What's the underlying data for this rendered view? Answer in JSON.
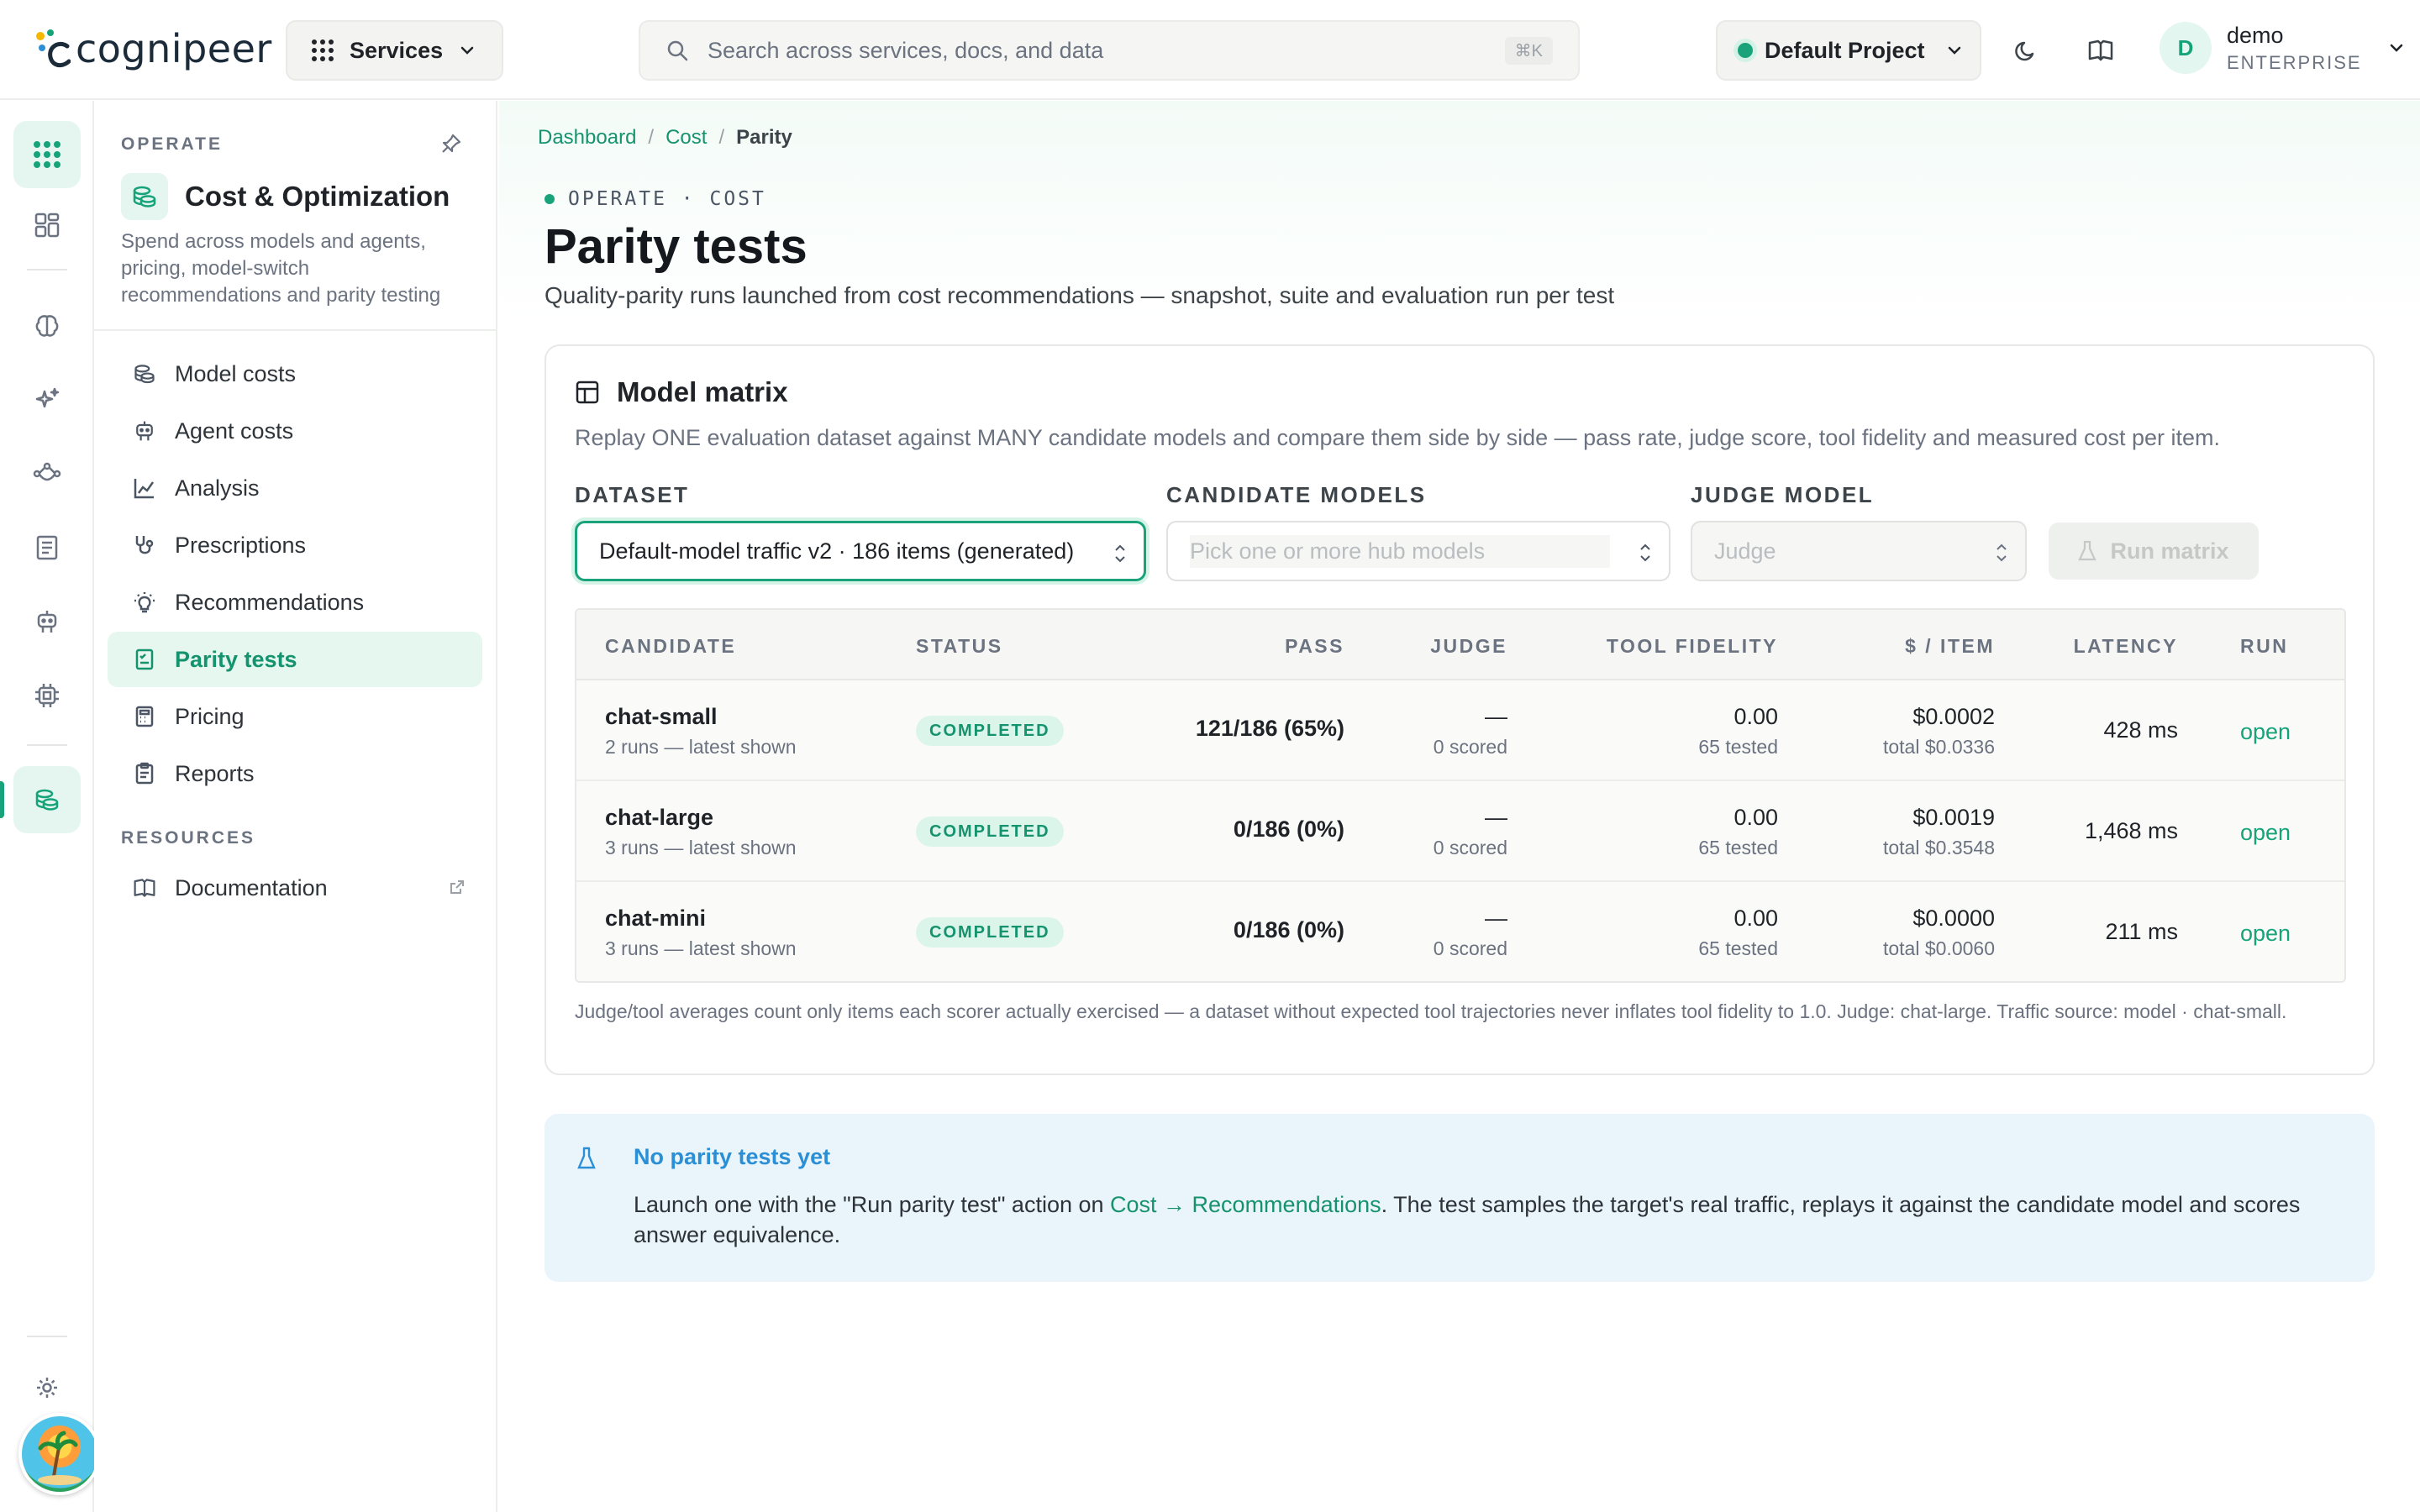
{
  "app": {
    "logo_text": "cognipeer",
    "services_label": "Services",
    "search_placeholder": "Search across services, docs, and data",
    "search_shortcut": "⌘K",
    "project_label": "Default Project",
    "user_name": "demo",
    "user_plan": "ENTERPRISE",
    "user_initial": "D"
  },
  "sidebar": {
    "section_operate": "OPERATE",
    "title": "Cost & Optimization",
    "description": "Spend across models and agents, pricing, model-switch recommendations and parity testing",
    "items": [
      {
        "label": "Model costs",
        "icon": "coins-icon"
      },
      {
        "label": "Agent costs",
        "icon": "robot-icon"
      },
      {
        "label": "Analysis",
        "icon": "chart-icon"
      },
      {
        "label": "Prescriptions",
        "icon": "stethoscope-icon"
      },
      {
        "label": "Recommendations",
        "icon": "lightbulb-icon"
      },
      {
        "label": "Parity tests",
        "icon": "checklist-icon",
        "active": true
      },
      {
        "label": "Pricing",
        "icon": "calculator-icon"
      },
      {
        "label": "Reports",
        "icon": "report-icon"
      }
    ],
    "section_resources": "RESOURCES",
    "resources": [
      {
        "label": "Documentation",
        "icon": "book-icon"
      }
    ]
  },
  "breadcrumb": {
    "items": [
      "Dashboard",
      "Cost",
      "Parity"
    ],
    "separator": "/"
  },
  "page": {
    "eyebrow": "OPERATE · COST",
    "title": "Parity tests",
    "subtitle": "Quality-parity runs launched from cost recommendations — snapshot, suite and evaluation run per test"
  },
  "matrix": {
    "title": "Model matrix",
    "description": "Replay ONE evaluation dataset against MANY candidate models and compare them side by side — pass rate, judge score, tool fidelity and measured cost per item.",
    "dataset_label": "DATASET",
    "dataset_value": "Default-model traffic v2 · 186 items (generated)",
    "candidates_label": "CANDIDATE MODELS",
    "candidates_placeholder": "Pick one or more hub models",
    "judge_label": "JUDGE MODEL",
    "judge_placeholder": "Judge",
    "run_label": "Run matrix",
    "columns": [
      "CANDIDATE",
      "STATUS",
      "PASS",
      "JUDGE",
      "TOOL FIDELITY",
      "$ / ITEM",
      "LATENCY",
      "RUN"
    ],
    "rows": [
      {
        "name": "chat-small",
        "runs": "2 runs — latest shown",
        "status": "COMPLETED",
        "pass": "121/186 (65%)",
        "judge": "—",
        "judge_sub": "0 scored",
        "tool": "0.00",
        "tool_sub": "65 tested",
        "cost": "$0.0002",
        "cost_sub": "total $0.0336",
        "latency": "428 ms",
        "run": "open"
      },
      {
        "name": "chat-large",
        "runs": "3 runs — latest shown",
        "status": "COMPLETED",
        "pass": "0/186 (0%)",
        "judge": "—",
        "judge_sub": "0 scored",
        "tool": "0.00",
        "tool_sub": "65 tested",
        "cost": "$0.0019",
        "cost_sub": "total $0.3548",
        "latency": "1,468 ms",
        "run": "open"
      },
      {
        "name": "chat-mini",
        "runs": "3 runs — latest shown",
        "status": "COMPLETED",
        "pass": "0/186 (0%)",
        "judge": "—",
        "judge_sub": "0 scored",
        "tool": "0.00",
        "tool_sub": "65 tested",
        "cost": "$0.0000",
        "cost_sub": "total $0.0060",
        "latency": "211 ms",
        "run": "open"
      }
    ],
    "footnote": "Judge/tool averages count only items each scorer actually exercised — a dataset without expected tool trajectories never inflates tool fidelity to 1.0. Judge: chat-large. Traffic source: model · chat-small."
  },
  "empty_state": {
    "title": "No parity tests yet",
    "body_before": "Launch one with the \"Run parity test\" action on ",
    "body_link": "Cost → Recommendations",
    "body_after": ". The test samples the target's real traffic, replays it against the candidate model and scores answer equivalence."
  },
  "colors": {
    "accent": "#1aa37a",
    "accent_soft": "#e4f6ef",
    "info_bg": "#eaf4fb",
    "info_title": "#2b8fd6"
  }
}
